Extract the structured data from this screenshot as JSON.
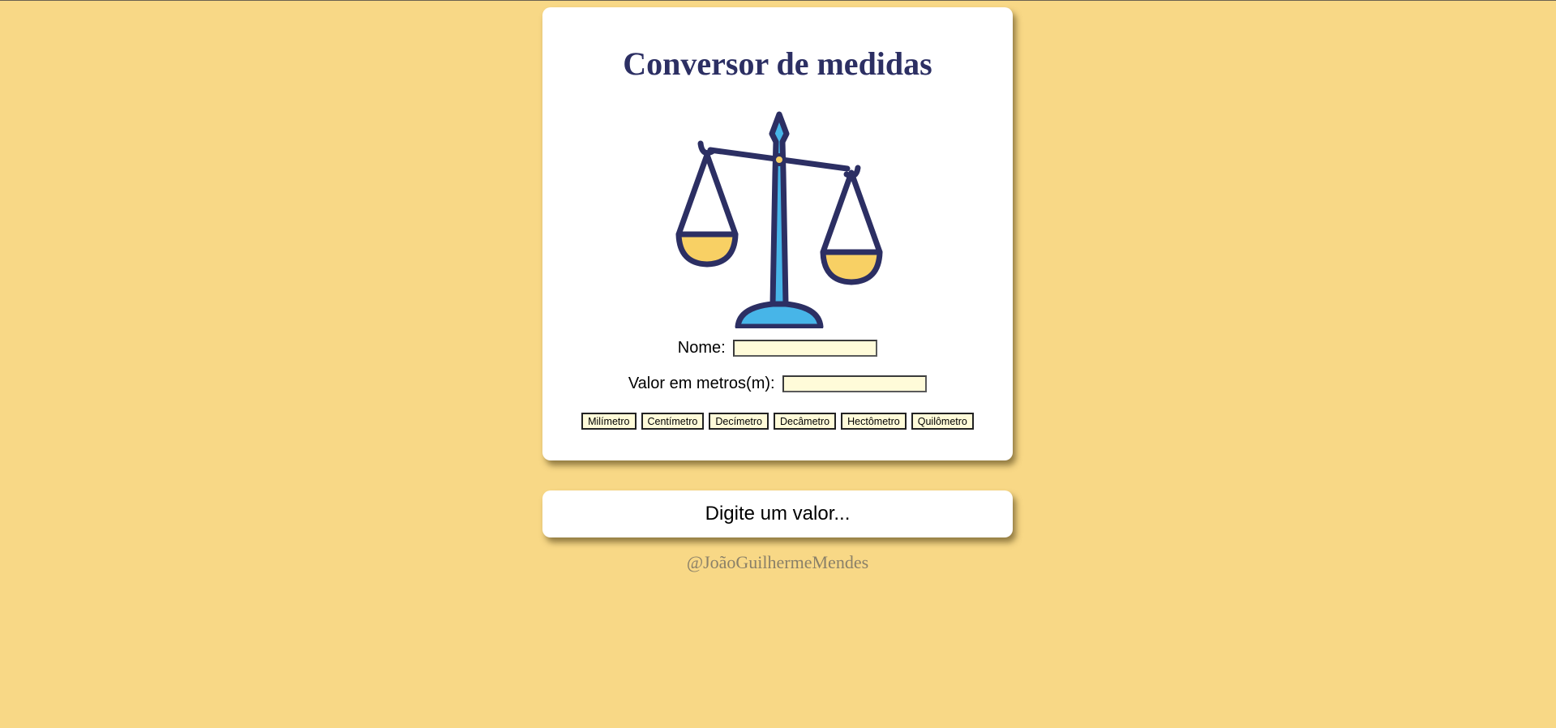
{
  "colors": {
    "background": "#F8D886",
    "card": "#FFFFFF",
    "title": "#2C2F63",
    "input_bg": "#FFFBD9",
    "logo_outline": "#2C2F63",
    "logo_pillar": "#47B5E8",
    "logo_pan": "#F8D064",
    "footer_text": "#8A8068"
  },
  "header": {
    "title": "Conversor de medidas",
    "logo_icon": "balance-scale-icon"
  },
  "form": {
    "nome_label": "Nome:",
    "nome_value": "",
    "valor_label": "Valor em metros(m):",
    "valor_value": ""
  },
  "buttons": [
    {
      "label": "Milímetro"
    },
    {
      "label": "Centímetro"
    },
    {
      "label": "Decímetro"
    },
    {
      "label": "Decâmetro"
    },
    {
      "label": "Hectômetro"
    },
    {
      "label": "Quilômetro"
    }
  ],
  "result": {
    "text": "Digite um valor..."
  },
  "footer": {
    "credit": "@JoãoGuilhermeMendes"
  }
}
